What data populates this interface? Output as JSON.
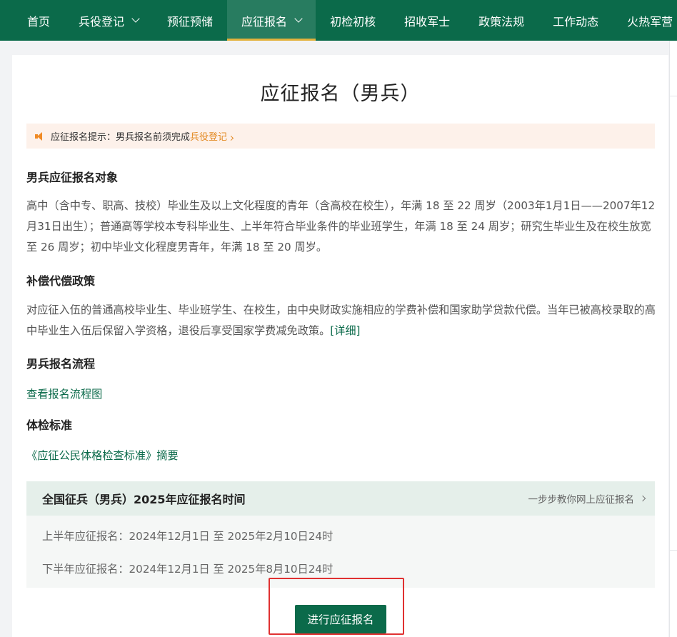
{
  "nav": {
    "items": [
      {
        "label": "首页"
      },
      {
        "label": "兵役登记"
      },
      {
        "label": "预征预储"
      },
      {
        "label": "应征报名"
      },
      {
        "label": "初检初核"
      },
      {
        "label": "招收军士"
      },
      {
        "label": "政策法规"
      },
      {
        "label": "工作动态"
      },
      {
        "label": "火热军营"
      }
    ]
  },
  "page": {
    "title": "应征报名（男兵）"
  },
  "notice": {
    "text": "应征报名提示：男兵报名前须完成",
    "link": "兵役登记"
  },
  "sections": {
    "target": {
      "heading": "男兵应征报名对象",
      "body": "高中（含中专、职高、技校）毕业生及以上文化程度的青年（含高校在校生），年满 18 至 22 周岁（2003年1月1日——2007年12月31日出生）；普通高等学校本专科毕业生、上半年符合毕业条件的毕业班学生，年满 18 至 24 周岁；研究生毕业生及在校生放宽至 26 周岁；初中毕业文化程度男青年，年满 18 至 20 周岁。"
    },
    "compensation": {
      "heading": "补偿代偿政策",
      "body": "对应征入伍的普通高校毕业生、毕业班学生、在校生，由中央财政实施相应的学费补偿和国家助学贷款代偿。当年已被高校录取的高中毕业生入伍后保留入学资格，退役后享受国家学费减免政策。",
      "detail_link": "[详细]"
    },
    "process": {
      "heading": "男兵报名流程",
      "link": "查看报名流程图"
    },
    "physical": {
      "heading": "体检标准",
      "link": "《应征公民体格检查标准》摘要"
    }
  },
  "schedule": {
    "title": "全国征兵（男兵）2025年应征报名时间",
    "guide_link": "一步步教你网上应征报名",
    "rows": [
      {
        "text": "上半年应征报名：2024年12月1日 至 2025年2月10日24时"
      },
      {
        "text": "下半年应征报名：2024年12月1日 至 2025年8月10日24时"
      }
    ]
  },
  "actions": {
    "apply_label": "进行应征报名"
  },
  "colors": {
    "brand_green": "#0b6a4a",
    "accent_gold": "#e2b13c",
    "notice_orange": "#e38a24",
    "highlight_red": "#e03131"
  }
}
